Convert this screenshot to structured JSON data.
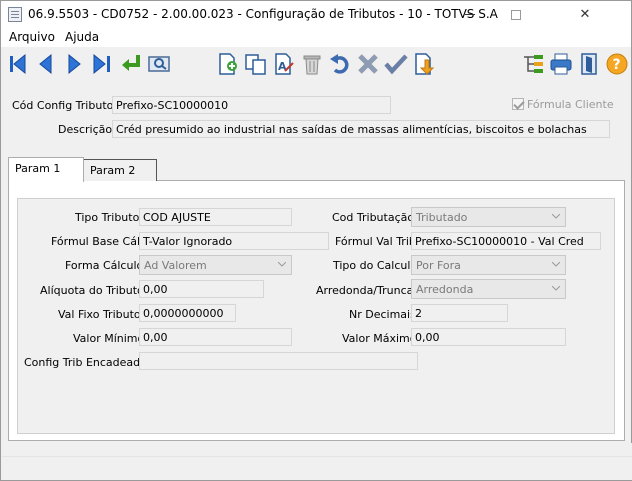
{
  "window": {
    "title": "06.9.5503 - CD0752 - 2.00.00.023 - Configuração de Tributos - 10 - TOTVS S.A - Ambient...",
    "minimize_label": "",
    "close_label": "✕"
  },
  "menu": {
    "arquivo": "Arquivo",
    "ajuda": "Ajuda"
  },
  "header": {
    "cod_config_label": "Cód Config Tributo:",
    "cod_config_value": "Prefixo-SC10000010",
    "formula_cliente_label": "Fórmula Cliente",
    "formula_cliente_checked": true,
    "descricao_label": "Descrição:",
    "descricao_value": "Créd presumido ao industrial nas saídas de massas alimentícias, biscoitos e bolachas"
  },
  "tabs": {
    "param1": "Param 1",
    "param2": "Param 2"
  },
  "form": {
    "tipo_tributo_label": "Tipo Tributo:",
    "tipo_tributo_value": "COD AJUSTE",
    "cod_tributacao_label": "Cod Tributação:",
    "cod_tributacao_value": "Tributado",
    "formul_base_label": "Fórmul Base Cálc:",
    "formul_base_value": "T-Valor Ignorado",
    "formul_val_label": "Fórmul Val Trib:",
    "formul_val_value": "Prefixo-SC10000010 - Val Cred",
    "forma_calculo_label": "Forma Cálculo:",
    "forma_calculo_value": "Ad Valorem",
    "tipo_calculo_label": "Tipo do Calculo:",
    "tipo_calculo_value": "Por Fora",
    "aliquota_label": "Alíquota do Tributo:",
    "aliquota_value": "0,00",
    "arredonda_label": "Arredonda/Trunca:",
    "arredonda_value": "Arredonda",
    "val_fixo_label": "Val Fixo Tributo:",
    "val_fixo_value": "0,0000000000",
    "nr_decimais_label": "Nr Decimais:",
    "nr_decimais_value": "2",
    "valor_minimo_label": "Valor Mínimo:",
    "valor_minimo_value": "0,00",
    "valor_maximo_label": "Valor Máximo:",
    "valor_maximo_value": "0,00",
    "config_encadeada_label": "Config Trib Encadeada:",
    "config_encadeada_value": ""
  },
  "toolbar_icons": [
    "first-record-icon",
    "previous-record-icon",
    "next-record-icon",
    "last-record-icon",
    "goto-icon",
    "search-icon",
    "add-icon",
    "copy-icon",
    "edit-icon",
    "delete-icon",
    "undo-icon",
    "cancel-icon",
    "save-icon",
    "record-export-icon",
    "tree-icon",
    "print-icon",
    "exit-icon",
    "help-icon"
  ]
}
